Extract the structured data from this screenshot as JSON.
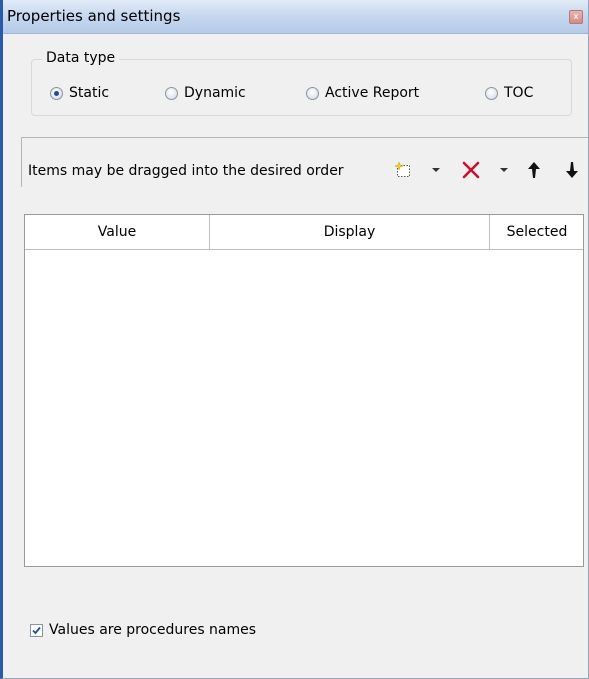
{
  "window": {
    "title": "Properties and settings",
    "close_glyph": "x"
  },
  "data_type": {
    "legend": "Data type",
    "options": [
      {
        "label": "Static",
        "checked": true
      },
      {
        "label": "Dynamic",
        "checked": false
      },
      {
        "label": "Active Report",
        "checked": false
      },
      {
        "label": "TOC",
        "checked": false
      }
    ]
  },
  "toolbar": {
    "hint": "Items may be dragged into the desired order",
    "icons": [
      "new-item-icon",
      "dropdown-arrow-icon",
      "delete-icon",
      "dropdown-arrow-icon",
      "move-up-icon",
      "move-down-icon"
    ]
  },
  "grid": {
    "columns": [
      "Value",
      "Display",
      "Selected"
    ],
    "rows": []
  },
  "options": {
    "procedures_label": "Values are procedures names",
    "procedures_checked": true
  },
  "colors": {
    "delete": "#c8102e",
    "accent": "#1f4f9c"
  }
}
